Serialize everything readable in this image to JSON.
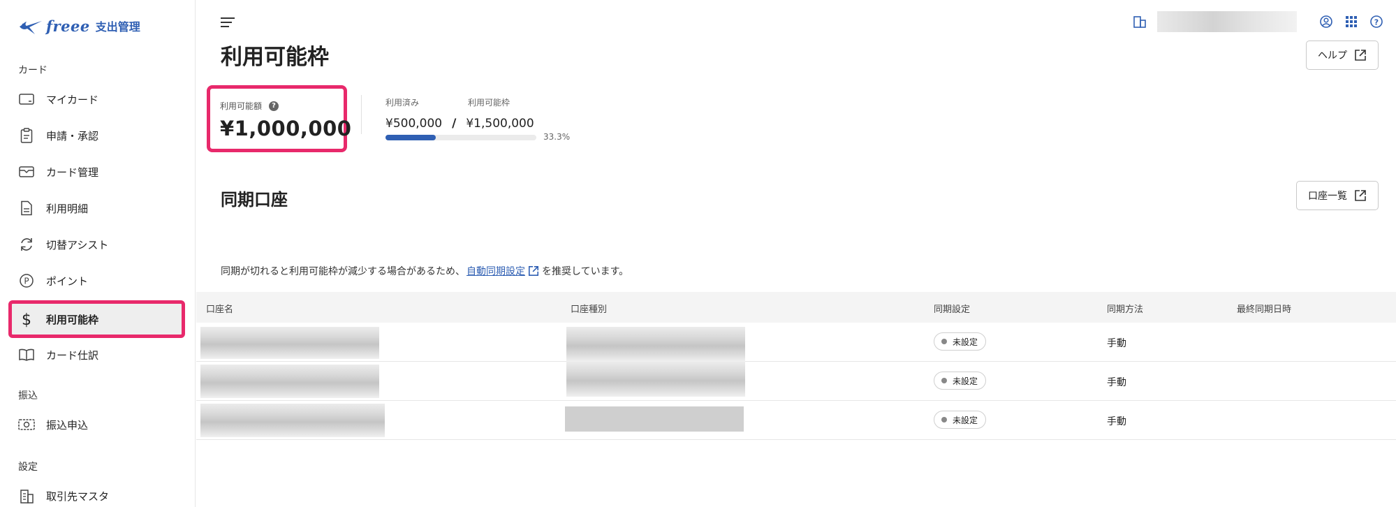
{
  "app": {
    "brand": "freee",
    "product": "支出管理"
  },
  "sidebar": {
    "sections": [
      {
        "label": "カード"
      },
      {
        "label": "振込"
      },
      {
        "label": "設定"
      }
    ],
    "items": [
      {
        "label": "マイカード",
        "icon": "credit-card-icon"
      },
      {
        "label": "申請・承認",
        "icon": "clipboard-icon"
      },
      {
        "label": "カード管理",
        "icon": "card-folder-icon"
      },
      {
        "label": "利用明細",
        "icon": "document-icon"
      },
      {
        "label": "切替アシスト",
        "icon": "refresh-icon"
      },
      {
        "label": "ポイント",
        "icon": "point-icon"
      },
      {
        "label": "利用可能枠",
        "icon": "dollar-icon",
        "active": true
      },
      {
        "label": "カード仕訳",
        "icon": "book-icon"
      },
      {
        "label": "振込申込",
        "icon": "cash-icon"
      },
      {
        "label": "取引先マスタ",
        "icon": "building-icon"
      }
    ]
  },
  "header": {
    "icons": [
      "company-icon",
      "account-icon",
      "apps-grid-icon",
      "help-icon"
    ]
  },
  "page": {
    "title": "利用可能枠",
    "help_button": "ヘルプ"
  },
  "limit": {
    "available_label": "利用可能額",
    "available_value": "¥1,000,000",
    "used_label": "利用済み",
    "used_value": "¥500,000",
    "total_label": "利用可能枠",
    "total_value": "¥1,500,000",
    "percent_text": "33.3%",
    "percent": 33.3,
    "accent": "#2f5fb3",
    "highlight": "#e8296b"
  },
  "sync": {
    "title": "同期口座",
    "list_button": "口座一覧",
    "notice_before": "同期が切れると利用可能枠が減少する場合があるため、",
    "notice_link": "自動同期設定",
    "notice_after": "を推奨しています。",
    "columns": [
      "口座名",
      "口座種別",
      "同期設定",
      "同期方法",
      "最終同期日時"
    ],
    "rows": [
      {
        "status": "未設定",
        "method": "手動"
      },
      {
        "status": "未設定",
        "method": "手動"
      },
      {
        "status": "未設定",
        "method": "手動"
      }
    ]
  }
}
